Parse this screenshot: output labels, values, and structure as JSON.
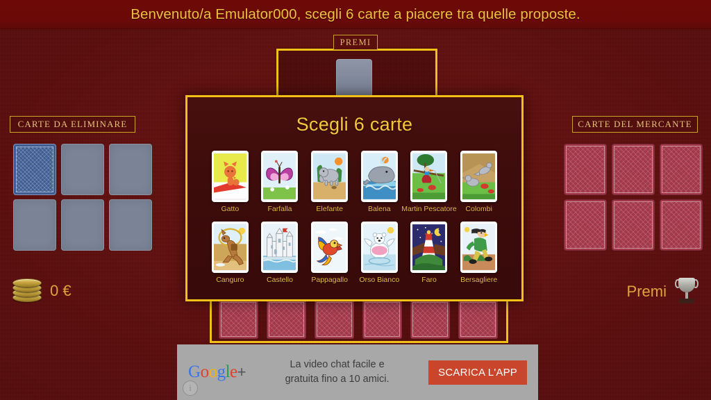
{
  "banner": {
    "message": "Benvenuto/a Emulator000, scegli 6 carte a piacere tra quelle proposte."
  },
  "premi_box": {
    "tab_label": "PREMI"
  },
  "left_panel": {
    "title": "CARTE DA ELIMINARE",
    "money": "0 €",
    "coin_icon": "coin-stack-icon",
    "slots": [
      {
        "state": "blue-back"
      },
      {
        "state": "empty"
      },
      {
        "state": "empty"
      },
      {
        "state": "empty"
      },
      {
        "state": "empty"
      },
      {
        "state": "empty"
      }
    ]
  },
  "right_panel": {
    "title": "CARTE DEL MERCANTE",
    "premi_label": "Premi",
    "trophy_icon": "trophy-icon",
    "slots": [
      {
        "state": "red-back"
      },
      {
        "state": "red-back"
      },
      {
        "state": "red-back"
      },
      {
        "state": "red-back"
      },
      {
        "state": "red-back"
      },
      {
        "state": "red-back"
      }
    ]
  },
  "bottom_row": {
    "count": 6,
    "state": "red-back"
  },
  "dialog": {
    "title": "Scegli 6 carte",
    "cards": [
      {
        "label": "Gatto",
        "art": "cat"
      },
      {
        "label": "Farfalla",
        "art": "butterfly"
      },
      {
        "label": "Elefante",
        "art": "elephant"
      },
      {
        "label": "Balena",
        "art": "whale"
      },
      {
        "label": "Martin Pescatore",
        "art": "kingfisher"
      },
      {
        "label": "Colombi",
        "art": "doves"
      },
      {
        "label": "Canguro",
        "art": "kangaroo"
      },
      {
        "label": "Castello",
        "art": "castle"
      },
      {
        "label": "Pappagallo",
        "art": "parrot"
      },
      {
        "label": "Orso Bianco",
        "art": "polarbear"
      },
      {
        "label": "Faro",
        "art": "lighthouse"
      },
      {
        "label": "Bersagliere",
        "art": "bersagliere"
      }
    ]
  },
  "ad": {
    "brand": "Google+",
    "text_line1": "La video chat facile e",
    "text_line2": "gratuita fino a 10 amici.",
    "button_label": "SCARICA L'APP",
    "info_icon": "info-icon"
  },
  "colors": {
    "background": "#5e1010",
    "banner": "#6a0907",
    "gold": "#f3c018",
    "title_text": "#f5c73c",
    "label_text": "#e8b94a",
    "money_text": "#e0a33c",
    "dialog_bg": "#3d0c0b",
    "ad_bg": "#a8a8a8",
    "ad_button": "#c9462c"
  }
}
